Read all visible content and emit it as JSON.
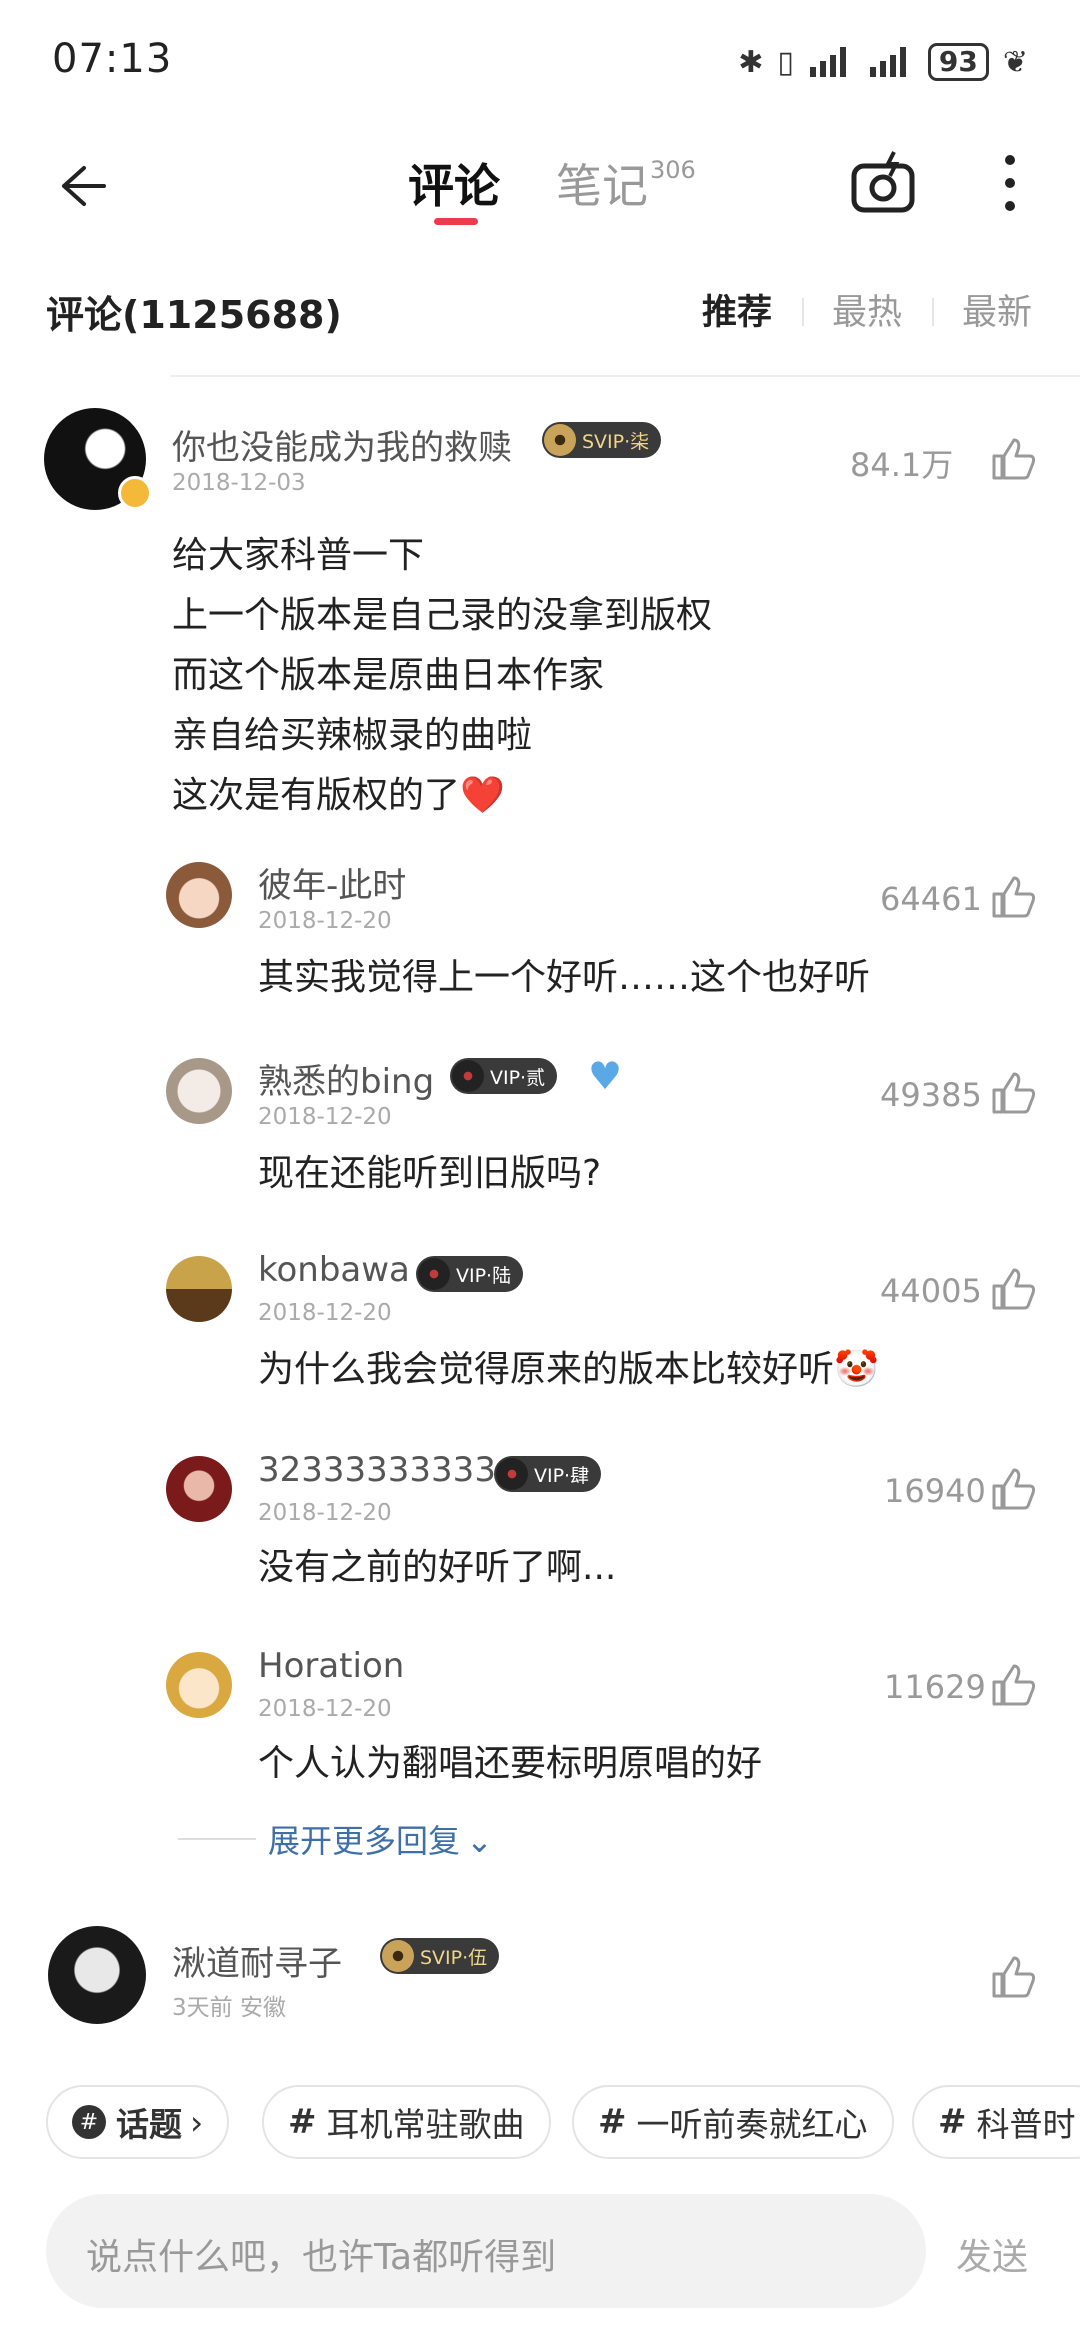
{
  "status_bar": {
    "time": "07:13",
    "battery": "93"
  },
  "nav": {
    "tab_comments": "评论",
    "tab_notes": "笔记",
    "notes_count": "306"
  },
  "comments_header": {
    "title": "评论(1125688)",
    "sort_recommend": "推荐",
    "sort_hot": "最热",
    "sort_new": "最新"
  },
  "main_comment": {
    "username": "你也没能成为我的救赎",
    "badge": "SVIP·柒",
    "date": "2018-12-03",
    "likes": "84.1万",
    "lines": [
      "给大家科普一下",
      "上一个版本是自己录的没拿到版权",
      "而这个版本是原曲日本作家",
      "亲自给买辣椒录的曲啦",
      "这次是有版权的了❤️"
    ]
  },
  "replies": [
    {
      "username": "彼年-此时",
      "date": "2018-12-20",
      "likes": "64461",
      "text": "其实我觉得上一个好听……这个也好听"
    },
    {
      "username": "熟悉的bing",
      "badge": "VIP·贰",
      "date": "2018-12-20",
      "likes": "49385",
      "text": "现在还能听到旧版吗?"
    },
    {
      "username": "konbawa",
      "badge": "VIP·陆",
      "date": "2018-12-20",
      "likes": "44005",
      "text": "为什么我会觉得原来的版本比较好听🤡"
    },
    {
      "username": "32333333333",
      "badge": "VIP·肆",
      "date": "2018-12-20",
      "likes": "16940",
      "text": "没有之前的好听了啊..."
    },
    {
      "username": "Horation",
      "date": "2018-12-20",
      "likes": "11629",
      "text": "个人认为翻唱还要标明原唱的好"
    }
  ],
  "expand_more": "展开更多回复",
  "next_comment": {
    "username": "湫道耐寻子",
    "badge": "SVIP·伍",
    "meta": "3天前 安徽"
  },
  "topics": {
    "topic_label": "话题",
    "chips": [
      "耳机常驻歌曲",
      "一听前奏就红心",
      "科普时"
    ]
  },
  "composer": {
    "placeholder": "说点什么吧，也许Ta都听得到",
    "send": "发送"
  },
  "colors": {
    "accent": "#ec3b4a",
    "link": "#3f6fa8",
    "badge_bg": "#3a3a3a"
  }
}
